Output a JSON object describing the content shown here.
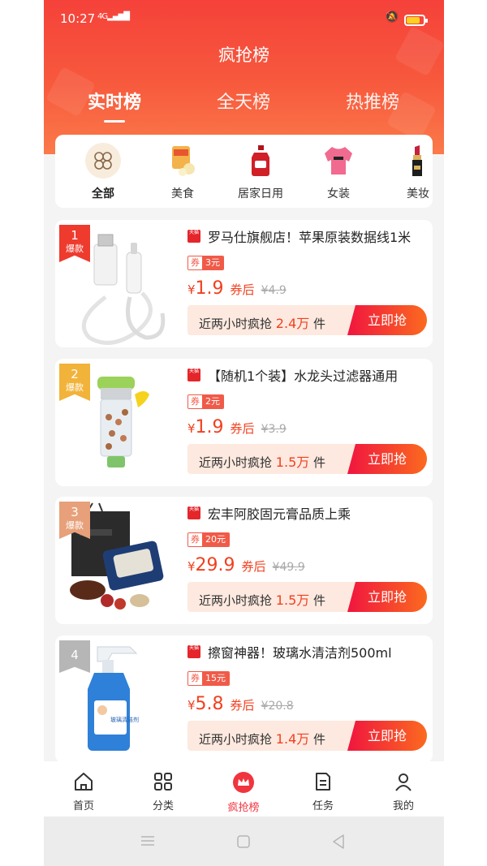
{
  "status_bar": {
    "time": "10:27",
    "network": "4G",
    "battery_level": 0.78
  },
  "header": {
    "title": "疯抢榜"
  },
  "tabs": [
    {
      "label": "实时榜",
      "active": true
    },
    {
      "label": "全天榜",
      "active": false
    },
    {
      "label": "热推榜",
      "active": false
    }
  ],
  "categories": [
    {
      "label": "全部",
      "icon": "grid-icon",
      "active": true
    },
    {
      "label": "美食",
      "icon": "snack-icon"
    },
    {
      "label": "居家日用",
      "icon": "detergent-icon"
    },
    {
      "label": "女装",
      "icon": "sweater-icon"
    },
    {
      "label": "美妆",
      "icon": "lipstick-icon"
    }
  ],
  "products": [
    {
      "rank": "1",
      "badge": "爆款",
      "store_tag": "天猫",
      "title": "罗马仕旗舰店！苹果原装数据线1米",
      "coupon_label": "券",
      "coupon": "3元",
      "currency": "¥",
      "price": "1.9",
      "price_suffix": "券后",
      "original_price": "¥4.9",
      "sold_prefix": "近两小时疯抢",
      "sold_count": "2.4万",
      "sold_unit": "件",
      "button": "立即抢",
      "image": "usb-cable-image"
    },
    {
      "rank": "2",
      "badge": "爆款",
      "store_tag": "天猫",
      "title": "【随机1个装】水龙头过滤器通用",
      "coupon_label": "券",
      "coupon": "2元",
      "currency": "¥",
      "price": "1.9",
      "price_suffix": "券后",
      "original_price": "¥3.9",
      "sold_prefix": "近两小时疯抢",
      "sold_count": "1.5万",
      "sold_unit": "件",
      "button": "立即抢",
      "image": "faucet-filter-image"
    },
    {
      "rank": "3",
      "badge": "爆款",
      "store_tag": "天猫",
      "title": "宏丰阿胶固元膏品质上乘",
      "coupon_label": "券",
      "coupon": "20元",
      "currency": "¥",
      "price": "29.9",
      "price_suffix": "券后",
      "original_price": "¥49.9",
      "sold_prefix": "近两小时疯抢",
      "sold_count": "1.5万",
      "sold_unit": "件",
      "button": "立即抢",
      "image": "gift-box-image"
    },
    {
      "rank": "4",
      "badge": "",
      "store_tag": "天猫",
      "title": "擦窗神器！玻璃水清洁剂500ml",
      "coupon_label": "券",
      "coupon": "15元",
      "currency": "¥",
      "price": "5.8",
      "price_suffix": "券后",
      "original_price": "¥20.8",
      "sold_prefix": "近两小时疯抢",
      "sold_count": "1.4万",
      "sold_unit": "件",
      "button": "立即抢",
      "image": "glass-cleaner-image",
      "bottle_label": "玻璃清洁剂"
    }
  ],
  "bottom_nav": [
    {
      "label": "首页",
      "icon": "home-icon"
    },
    {
      "label": "分类",
      "icon": "category-icon"
    },
    {
      "label": "疯抢榜",
      "icon": "crown-icon",
      "active": true
    },
    {
      "label": "任务",
      "icon": "task-icon"
    },
    {
      "label": "我的",
      "icon": "profile-icon"
    }
  ],
  "colors": {
    "primary": "#f5413a",
    "price": "#f1401f",
    "button_start": "#f0153f",
    "button_end": "#fb6a1f"
  }
}
